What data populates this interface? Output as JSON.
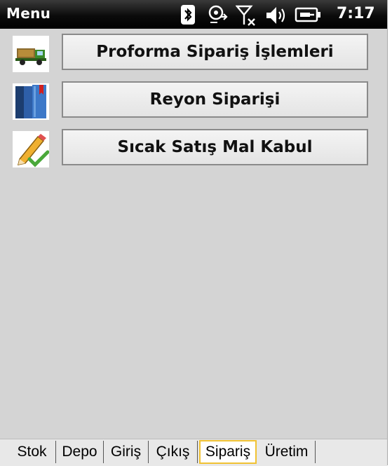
{
  "statusbar": {
    "title": "Menu",
    "time": "7:17",
    "icons": [
      "bluetooth-icon",
      "sync-icon",
      "no-signal-icon",
      "volume-icon",
      "battery-charging-icon"
    ]
  },
  "menu": {
    "items": [
      {
        "label": "Proforma Sipariş İşlemleri",
        "icon": "truck-icon"
      },
      {
        "label": "Reyon Siparişi",
        "icon": "books-icon"
      },
      {
        "label": "Sıcak Satış Mal Kabul",
        "icon": "pencil-check-icon"
      }
    ]
  },
  "tabs": {
    "items": [
      "Stok",
      "Depo",
      "Giriş",
      "Çıkış",
      "Sipariş",
      "Üretim"
    ],
    "active": "Sipariş"
  },
  "colors": {
    "statusbar_bg": "#000000",
    "content_bg": "#d4d4d4",
    "active_tab_border": "#f1c233"
  }
}
